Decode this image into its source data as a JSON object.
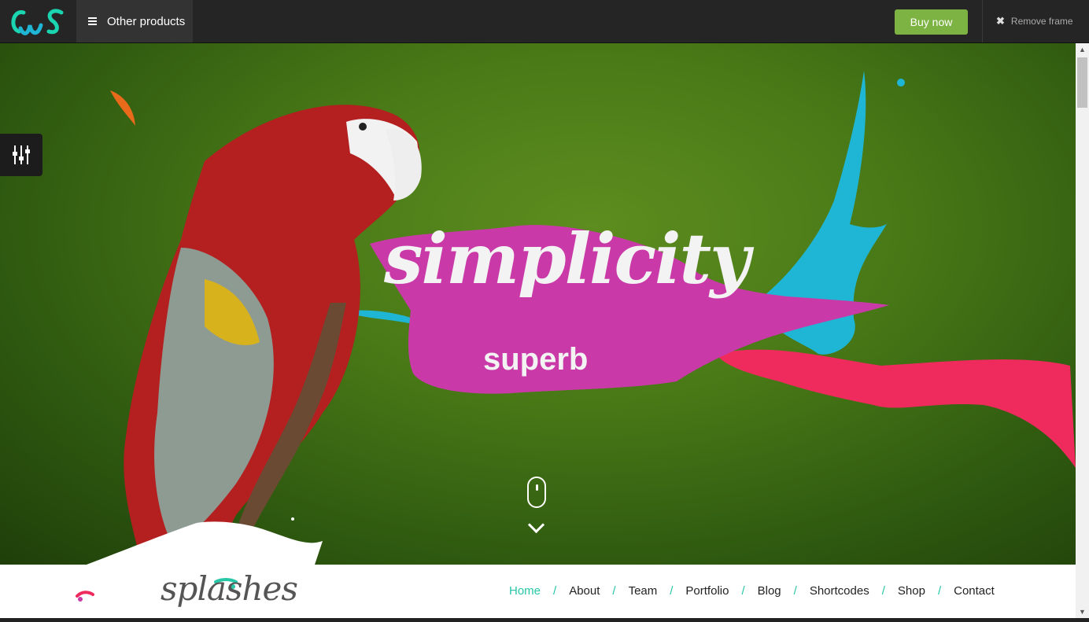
{
  "topbar": {
    "logo_alt": "CWS",
    "other_products": "Other products",
    "buy_now": "Buy now",
    "remove_frame": "Remove frame"
  },
  "hero": {
    "headline": "simplicity",
    "subline": "superb"
  },
  "nav": {
    "brand": "splashes",
    "items": [
      {
        "label": "Home",
        "active": true
      },
      {
        "label": "About"
      },
      {
        "label": "Team"
      },
      {
        "label": "Portfolio"
      },
      {
        "label": "Blog"
      },
      {
        "label": "Shortcodes"
      },
      {
        "label": "Shop"
      },
      {
        "label": "Contact"
      }
    ]
  },
  "colors": {
    "accent": "#26c6a6",
    "buy": "#7cb342",
    "magenta": "#c93aa8",
    "pink": "#ef2b5e",
    "cyan": "#1fb6d6"
  }
}
